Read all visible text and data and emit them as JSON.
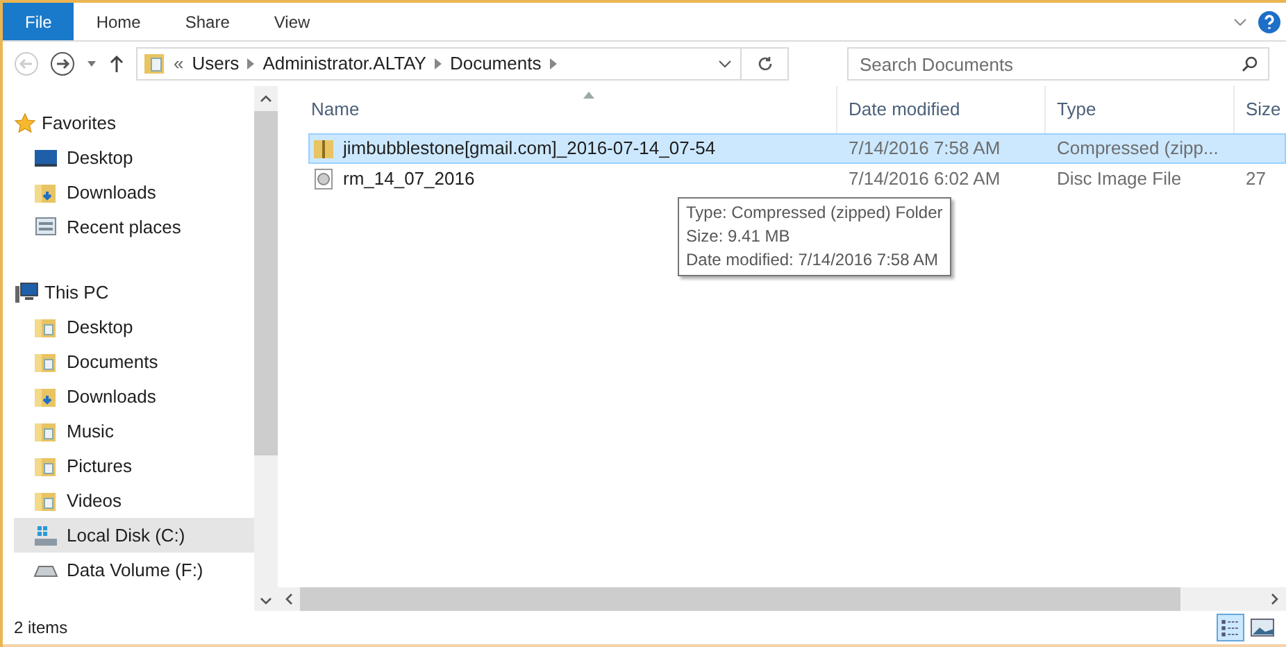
{
  "ribbon": {
    "tabs": [
      {
        "label": "File",
        "selected": true
      },
      {
        "label": "Home",
        "selected": false
      },
      {
        "label": "Share",
        "selected": false
      },
      {
        "label": "View",
        "selected": false
      }
    ]
  },
  "address": {
    "separator": "«",
    "crumbs": [
      "Users",
      "Administrator.ALTAY",
      "Documents"
    ]
  },
  "search": {
    "placeholder": "Search Documents"
  },
  "sidebar": {
    "groups": [
      {
        "label": "Favorites",
        "kind": "star",
        "children": [
          {
            "label": "Desktop",
            "kind": "desktop",
            "selected": false
          },
          {
            "label": "Downloads",
            "kind": "downloads",
            "selected": false
          },
          {
            "label": "Recent places",
            "kind": "recent",
            "selected": false
          }
        ]
      },
      {
        "label": "This PC",
        "kind": "pc",
        "children": [
          {
            "label": "Desktop",
            "kind": "folder",
            "selected": false
          },
          {
            "label": "Documents",
            "kind": "folder",
            "selected": false
          },
          {
            "label": "Downloads",
            "kind": "downloads",
            "selected": false
          },
          {
            "label": "Music",
            "kind": "folder",
            "selected": false
          },
          {
            "label": "Pictures",
            "kind": "folder",
            "selected": false
          },
          {
            "label": "Videos",
            "kind": "folder",
            "selected": false
          },
          {
            "label": "Local Disk (C:)",
            "kind": "disk",
            "selected": true
          },
          {
            "label": "Data Volume (F:)",
            "kind": "drive",
            "selected": false
          }
        ]
      }
    ]
  },
  "table": {
    "columns": [
      "Name",
      "Date modified",
      "Type",
      "Size"
    ],
    "rows": [
      {
        "name": "jimbubblestone[gmail.com]_2016-07-14_07-54",
        "date": "7/14/2016 7:58 AM",
        "type": "Compressed (zipp...",
        "size": "",
        "kind": "zip",
        "selected": true
      },
      {
        "name": "rm_14_07_2016",
        "date": "7/14/2016 6:02 AM",
        "type": "Disc Image File",
        "size": "27",
        "kind": "disc",
        "selected": false
      }
    ]
  },
  "tooltip": {
    "lines": [
      "Type: Compressed (zipped) Folder",
      "Size: 9.41 MB",
      "Date modified: 7/14/2016 7:58 AM"
    ]
  },
  "status_bar": {
    "text": "2 items"
  }
}
